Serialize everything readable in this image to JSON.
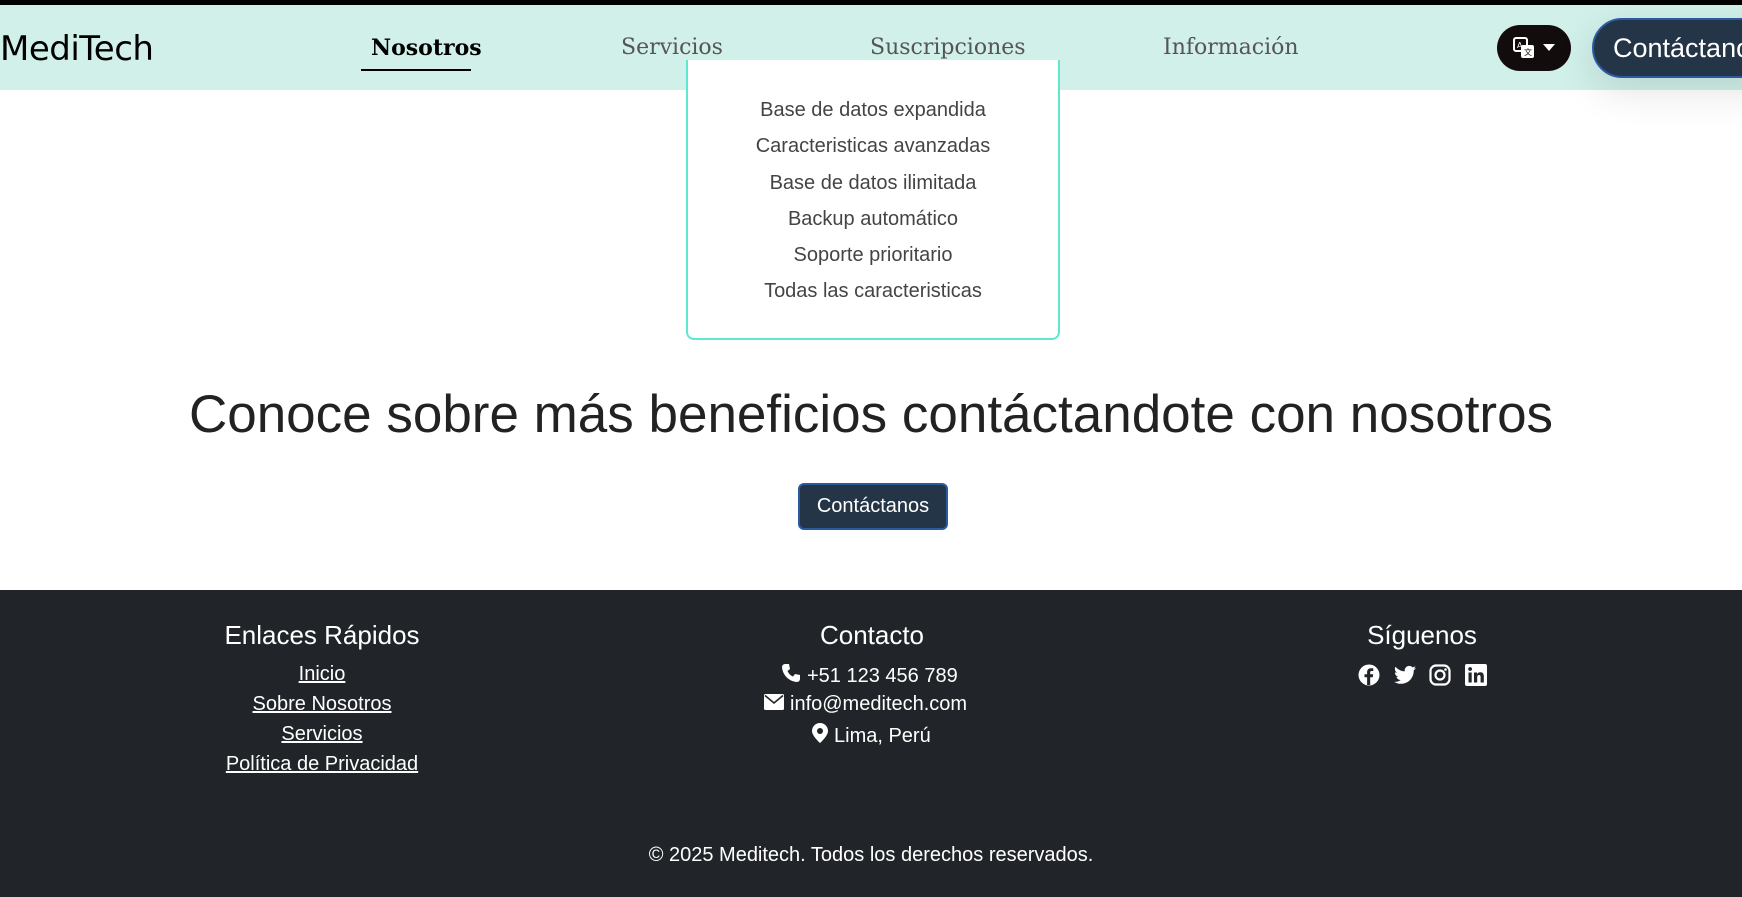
{
  "nav": {
    "brand": "MediTech",
    "links": [
      "Nosotros",
      "Servicios",
      "Suscripciones",
      "Información"
    ],
    "contact_label": "Contáctanos"
  },
  "plan_features": [
    "Base de datos expandida",
    "Caracteristicas avanzadas",
    "Base de datos ilimitada",
    "Backup automático",
    "Soporte prioritario",
    "Todas las caracteristicas"
  ],
  "cta": {
    "headline": "Conoce sobre más beneficios contáctandote con nosotros",
    "button_label": "Contáctanos"
  },
  "footer": {
    "quick_links_title": "Enlaces Rápidos",
    "quick_links": [
      "Inicio",
      "Sobre Nosotros",
      "Servicios",
      "Política de Privacidad"
    ],
    "contact_title": "Contacto",
    "phone": "+51 123 456 789",
    "email": "info@meditech.com",
    "location": "Lima, Perú",
    "follow_title": "Síguenos",
    "social_icons": [
      "facebook-icon",
      "twitter-icon",
      "instagram-icon",
      "linkedin-icon"
    ],
    "copyright": "© 2025 Meditech. Todos los derechos reservados."
  },
  "colors": {
    "navbar_bg": "#d1f0ea",
    "primary_button": "#253548",
    "card_border": "#5ee8cf",
    "footer_bg": "#212529"
  }
}
